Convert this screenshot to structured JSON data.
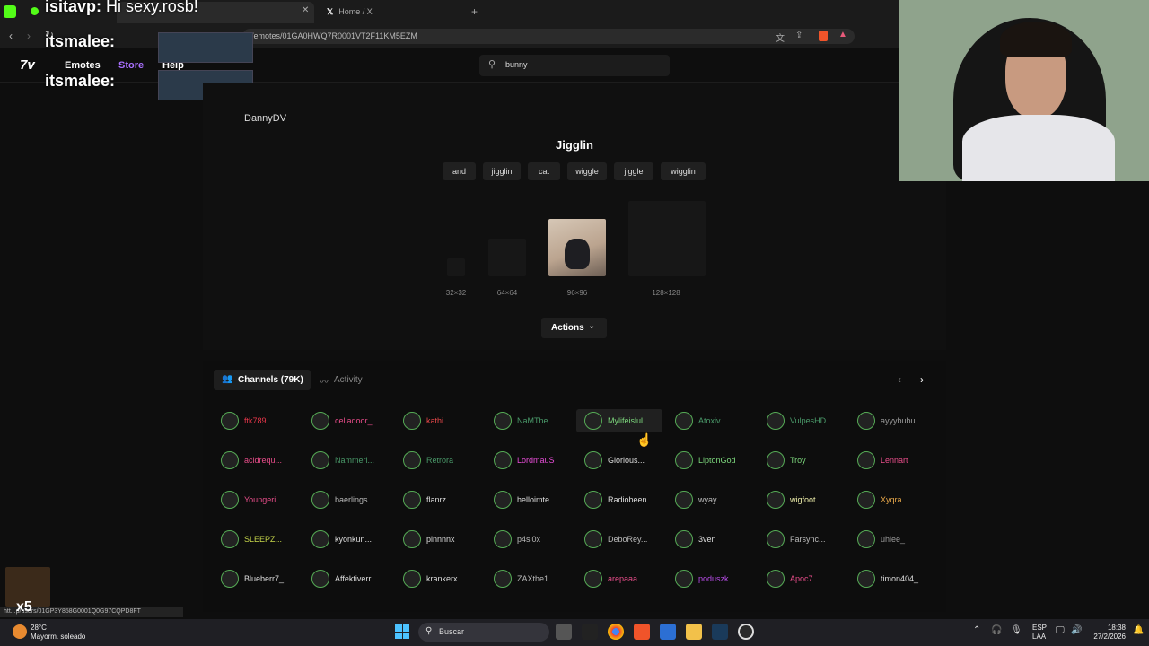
{
  "browser": {
    "tabs": [
      {
        "label": "Home / X"
      }
    ],
    "new_tab_glyph": "+",
    "url": "/emotes/01GA0HWQ7R0001VT2F11KM5EZM",
    "status_url": "htt...p/users/01GP3Y858G0001Q0G97CQPD8FT"
  },
  "overlay_chat": {
    "line1_user": "isitavp:",
    "line1_text": "Hi sexy.rosb!",
    "line2_user": "itsmalee:",
    "line3_user": "itsmalee:",
    "count": "x5"
  },
  "site": {
    "logo": "7v",
    "nav": [
      {
        "label": "Emotes"
      },
      {
        "label": "Store"
      },
      {
        "label": "Help"
      }
    ],
    "search_value": "bunny"
  },
  "emote": {
    "owner": "DannyDV",
    "name": "Jigglin",
    "tags": [
      "and",
      "jigglin",
      "cat",
      "wiggle",
      "jiggle",
      "wigglin"
    ],
    "sizes": [
      "32×32",
      "64×64",
      "96×96",
      "128×128"
    ],
    "actions_label": "Actions"
  },
  "channels": {
    "tab_channels": "Channels (79K)",
    "tab_activity": "Activity",
    "items": [
      {
        "name": "ftk789",
        "color": "#e8364a"
      },
      {
        "name": "celladoor_",
        "color": "#e84d8a"
      },
      {
        "name": "kathi",
        "color": "#e8484a"
      },
      {
        "name": "NaMThe...",
        "color": "#4a9a6a"
      },
      {
        "name": "Mylifeislul",
        "color": "#7dd87d"
      },
      {
        "name": "Atoxiv",
        "color": "#4a9a6a"
      },
      {
        "name": "VulpesHD",
        "color": "#4a9a6a"
      },
      {
        "name": "ayyybubu",
        "color": "#999999"
      },
      {
        "name": "acidrequ...",
        "color": "#e84d8a"
      },
      {
        "name": "Nammeri...",
        "color": "#4a9a6a"
      },
      {
        "name": "Retrora",
        "color": "#4a9a6a"
      },
      {
        "name": "LordmauS",
        "color": "#e84dd8"
      },
      {
        "name": "Glorious...",
        "color": "#dddddd"
      },
      {
        "name": "LiptonGod",
        "color": "#7dd87d"
      },
      {
        "name": "Troy",
        "color": "#7dd87d"
      },
      {
        "name": "Lennart",
        "color": "#e84d8a"
      },
      {
        "name": "Youngeri...",
        "color": "#e84d8a"
      },
      {
        "name": "baerlings",
        "color": "#bbbbbb"
      },
      {
        "name": "flanrz",
        "color": "#dddddd"
      },
      {
        "name": "helloimte...",
        "color": "#dddddd"
      },
      {
        "name": "Radiobeen",
        "color": "#dddddd"
      },
      {
        "name": "wyay",
        "color": "#bbbbbb"
      },
      {
        "name": "wigfoot",
        "color": "#eeeeaa"
      },
      {
        "name": "Xyqra",
        "color": "#e8a84a"
      },
      {
        "name": "SLEEPZ...",
        "color": "#c8d84a"
      },
      {
        "name": "kyonkun...",
        "color": "#dddddd"
      },
      {
        "name": "pinnnnx",
        "color": "#dddddd"
      },
      {
        "name": "p4si0x",
        "color": "#bbbbbb"
      },
      {
        "name": "DeboRey...",
        "color": "#bbbbbb"
      },
      {
        "name": "3ven",
        "color": "#dddddd"
      },
      {
        "name": "Farsync...",
        "color": "#bbbbbb"
      },
      {
        "name": "uhlee_",
        "color": "#999999"
      },
      {
        "name": "Blueberr7_",
        "color": "#dddddd"
      },
      {
        "name": "Affektiverr",
        "color": "#dddddd"
      },
      {
        "name": "krankerx",
        "color": "#dddddd"
      },
      {
        "name": "ZAXthe1",
        "color": "#bbbbbb"
      },
      {
        "name": "arepaaa...",
        "color": "#e84d8a"
      },
      {
        "name": "poduszk...",
        "color": "#b84de8"
      },
      {
        "name": "Apoc7",
        "color": "#e84d8a"
      },
      {
        "name": "timon404_",
        "color": "#dddddd"
      }
    ]
  },
  "taskbar": {
    "weather_temp": "28°C",
    "weather_desc": "Mayorm. soleado",
    "search_label": "Buscar",
    "lang1": "ESP",
    "lang2": "LAA",
    "time": "18:38",
    "date": "27/2/2026"
  }
}
